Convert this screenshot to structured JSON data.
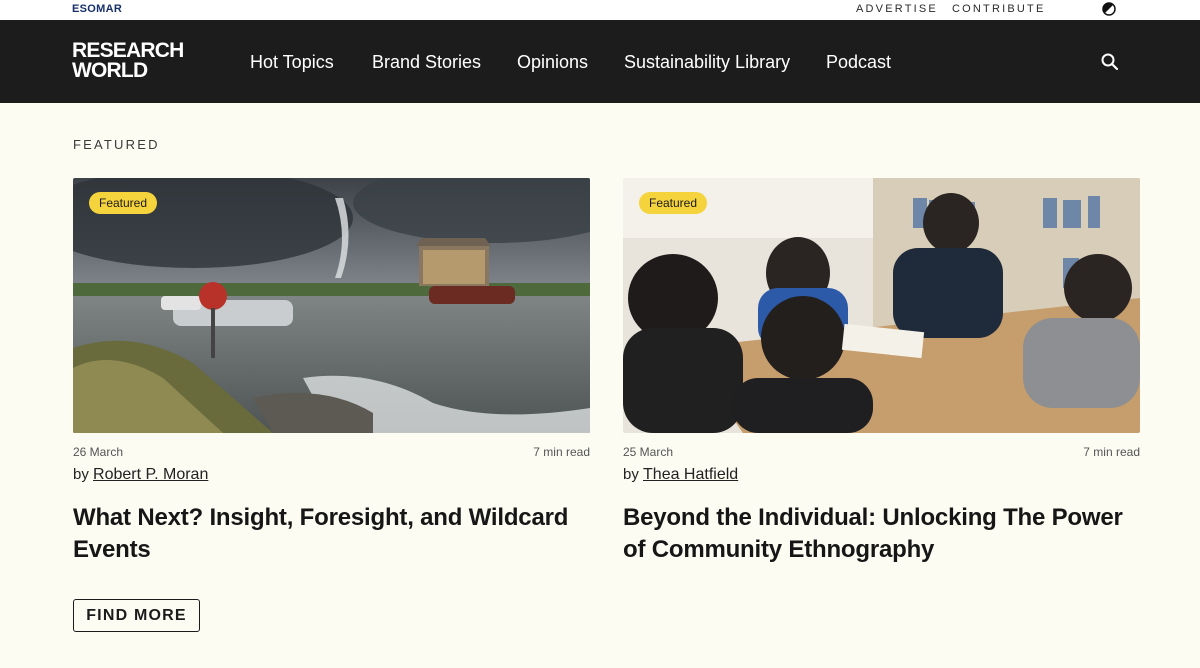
{
  "topbar": {
    "brand": "ESOMAR",
    "advertise": "ADVERTISE",
    "contribute": "CONTRIBUTE",
    "theme_icon": "half-moon-icon"
  },
  "nav": {
    "logo_line1": "RESEARCH",
    "logo_line2": "WORLD",
    "items": [
      {
        "label": "Hot Topics"
      },
      {
        "label": "Brand Stories"
      },
      {
        "label": "Opinions"
      },
      {
        "label": "Sustainability Library"
      },
      {
        "label": "Podcast"
      }
    ],
    "search_icon": "search-icon"
  },
  "featured": {
    "section_label": "FEATURED",
    "cards": [
      {
        "badge": "Featured",
        "date": "26 March",
        "read_time": "7 min read",
        "by": "by",
        "author": "Robert P. Moran",
        "title": "What Next? Insight, Foresight, and Wildcard Events"
      },
      {
        "badge": "Featured",
        "date": "25 March",
        "read_time": "7 min read",
        "by": "by",
        "author": "Thea Hatfield",
        "title": "Beyond the Individual: Unlocking The Power of Community Ethnography"
      }
    ],
    "find_more": "FIND MORE"
  },
  "colors": {
    "nav_bg": "#1c1c1c",
    "page_bg": "#fcfcf3",
    "badge_bg": "#f5d33d",
    "brand_blue": "#17306b"
  }
}
